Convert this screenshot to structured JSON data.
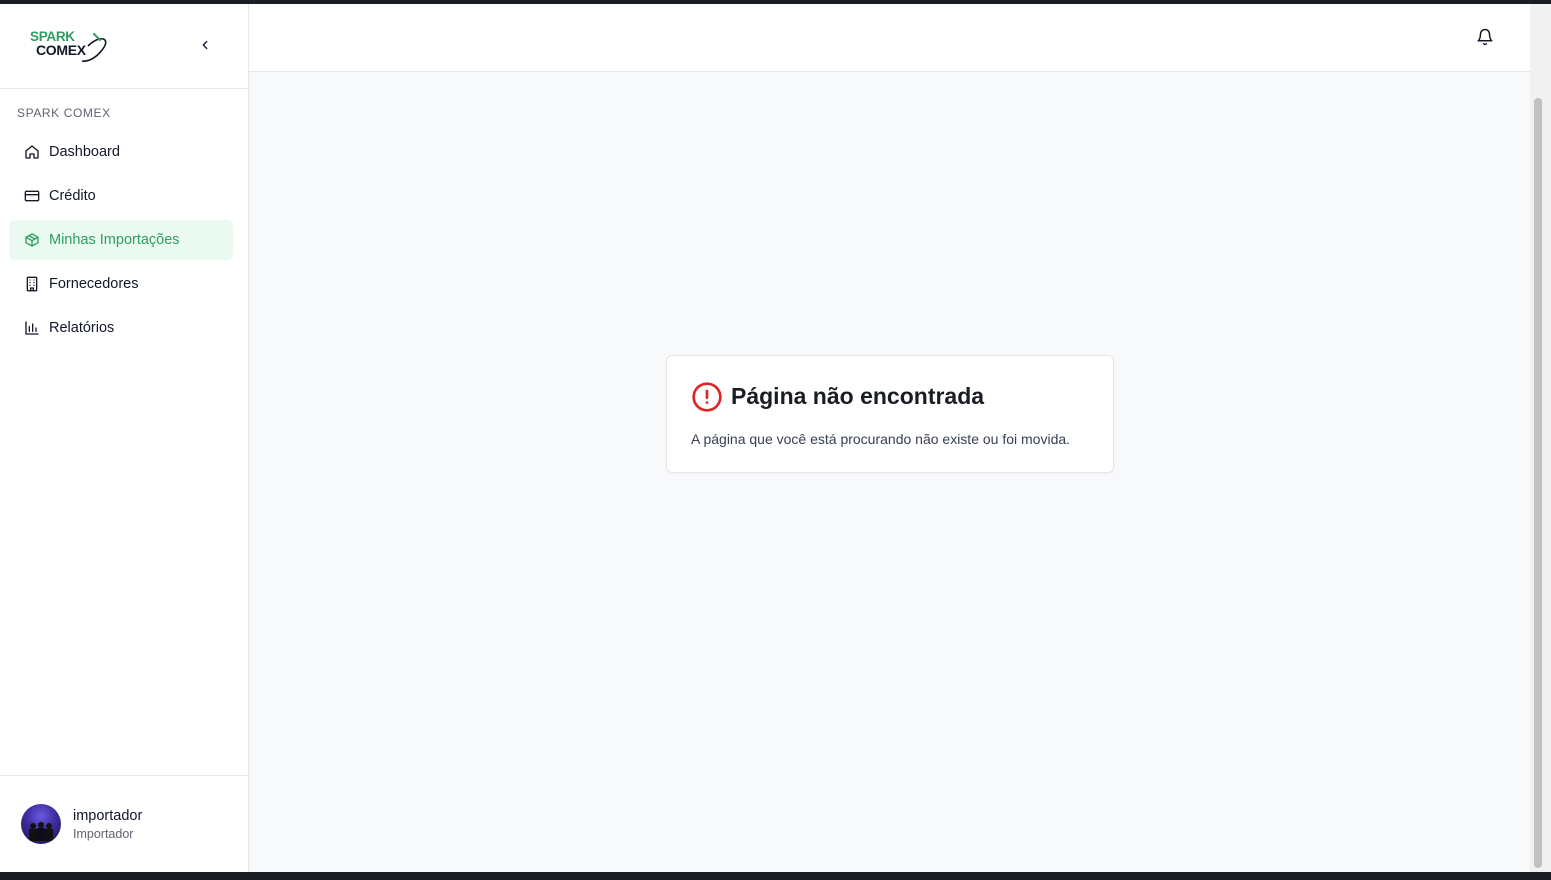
{
  "brand": {
    "logo_line1": "SPARK",
    "logo_line2": "COMEX",
    "accent_color": "#2f9e60"
  },
  "sidebar": {
    "section_label": "SPARK COMEX",
    "items": [
      {
        "label": "Dashboard",
        "icon": "home-icon",
        "active": false
      },
      {
        "label": "Crédito",
        "icon": "credit-card-icon",
        "active": false
      },
      {
        "label": "Minhas Importações",
        "icon": "package-icon",
        "active": true
      },
      {
        "label": "Fornecedores",
        "icon": "building-icon",
        "active": false
      },
      {
        "label": "Relatórios",
        "icon": "bar-chart-icon",
        "active": false
      }
    ],
    "user": {
      "name": "importador",
      "role": "Importador"
    }
  },
  "topbar": {
    "notification_icon": "bell-icon"
  },
  "error_card": {
    "icon": "alert-circle-icon",
    "icon_color": "#dc2626",
    "title": "Página não encontrada",
    "message": "A página que você está procurando não existe ou foi movida."
  }
}
